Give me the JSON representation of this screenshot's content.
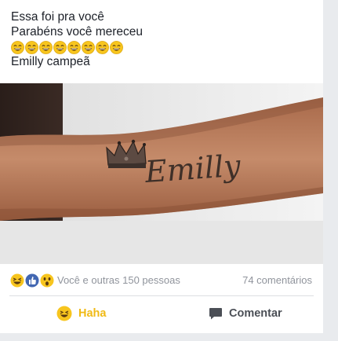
{
  "post": {
    "lines": [
      "Essa foi pra você",
      "Parabéns você mereceu"
    ],
    "emoji_name": "laughing-emoji",
    "emoji_count": 8,
    "last_line": "Emilly campeã"
  },
  "photo": {
    "tattoo_text": "Emilly",
    "icon_crown": "crown-icon"
  },
  "reactions": {
    "icons": [
      "haha",
      "like",
      "wow"
    ],
    "summary": "Você e outras 150 pessoas",
    "comments": "74 comentários"
  },
  "actions": {
    "haha_label": "Haha",
    "comment_label": "Comentar"
  },
  "colors": {
    "haha": "#f0ba15",
    "like": "#4267b2",
    "muted_text": "#90949c",
    "action_text": "#4b4f56"
  }
}
